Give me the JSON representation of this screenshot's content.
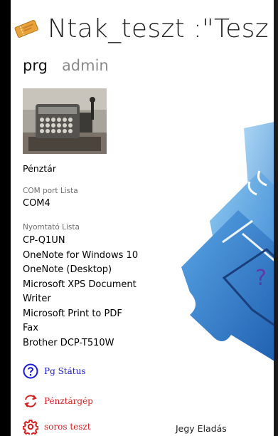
{
  "app": {
    "title": "Ntak_teszt :\"Tesz",
    "icon": "ticket-icon"
  },
  "pivot": {
    "tabs": [
      {
        "label": "prg",
        "selected": true
      },
      {
        "label": "admin",
        "selected": false
      }
    ]
  },
  "device": {
    "image": "cash-register-photo",
    "label": "Pénztár"
  },
  "com_port": {
    "caption": "COM port Lista",
    "value": "COM4"
  },
  "printers": {
    "caption": "Nyomtató Lista",
    "items": [
      "CP-Q1UN",
      "OneNote for Windows 10",
      "OneNote (Desktop)",
      "Microsoft XPS Document",
      "Writer",
      "Microsoft Print to PDF",
      "Fax",
      "Brother DCP-T510W"
    ]
  },
  "nav": {
    "pg_status": {
      "label": "Pg  Státus",
      "icon": "help-circle-icon",
      "color": "#1a1ad6"
    },
    "penztargep": {
      "label": "Pénztárgép",
      "icon": "refresh-icon",
      "color": "#d71f1f"
    },
    "soros_teszt": {
      "label": "soros  teszt",
      "icon": "gear-icon",
      "color": "#d71f1f"
    }
  },
  "tile": {
    "label": "Jegy Eladás",
    "art": "ticket-illustration",
    "color": "#3a8fd6"
  },
  "colors": {
    "window_background": "#ffffff",
    "outer_background": "#000000",
    "link_blue": "#1a1ad6",
    "link_red": "#d71f1f"
  }
}
